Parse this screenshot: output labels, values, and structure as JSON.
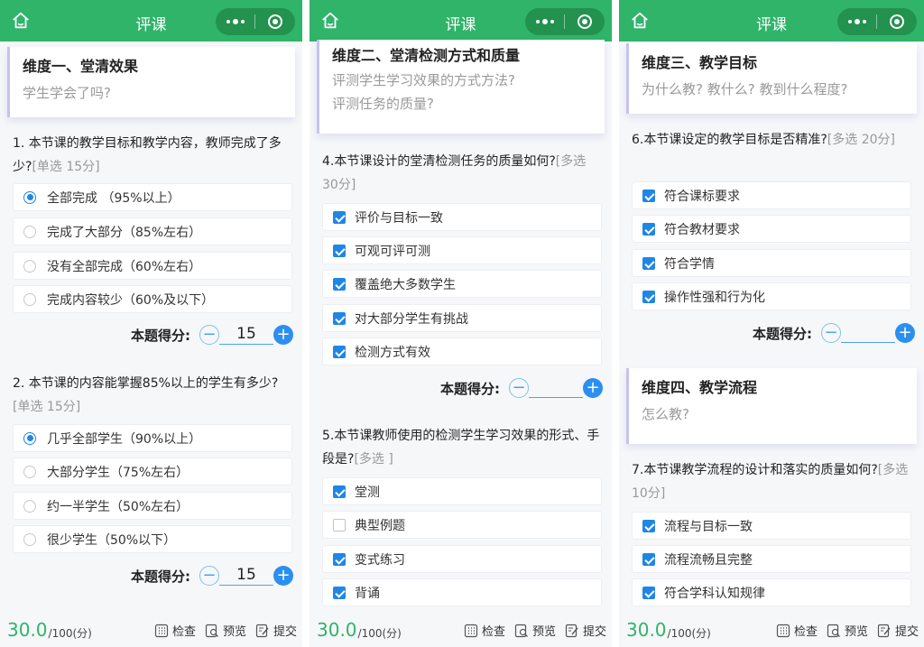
{
  "header": {
    "title": "评课"
  },
  "footer": {
    "total": "30.0",
    "of": "/100(分)",
    "check": "检查",
    "preview": "预览",
    "submit": "提交"
  },
  "p1": {
    "dim": {
      "title": "维度一、堂清效果",
      "sub": "学生学会了吗?"
    },
    "q1": {
      "text": "1. 本节课的教学目标和教学内容，教师完成了多少?",
      "tag": "[单选 15分]",
      "options": [
        "全部完成 （95%以上）",
        "完成了大部分（85%左右）",
        "没有全部完成（60%左右）",
        "完成内容较少（60%及以下）"
      ],
      "selected": 0,
      "score_label": "本题得分:",
      "score": "15"
    },
    "q2": {
      "text": "2. 本节课的内容能掌握85%以上的学生有多少?",
      "tag": "[单选 15分]",
      "options": [
        "几乎全部学生（90%以上）",
        "大部分学生（75%左右）",
        "约一半学生（50%左右）",
        "很少学生（50%以下）"
      ],
      "selected": 0,
      "score_label": "本题得分:",
      "score": "15"
    }
  },
  "p2": {
    "dim": {
      "title": "维度二、堂清检测方式和质量",
      "sub1": "评测学生学习效果的方式方法?",
      "sub2": "评测任务的质量?"
    },
    "q4": {
      "text": "4.本节课设计的堂清检测任务的质量如何?",
      "tag": "[多选 30分]",
      "options": [
        "评价与目标一致",
        "可观可评可测",
        "覆盖绝大多数学生",
        "对大部分学生有挑战",
        "检测方式有效"
      ],
      "checked": [
        true,
        true,
        true,
        true,
        true
      ],
      "score_label": "本题得分:",
      "score": ""
    },
    "q5": {
      "text": "5.本节课教师使用的检测学生学习效果的形式、手段是?",
      "tag": "[多选 ]",
      "options": [
        "堂测",
        "典型例题",
        "变式练习",
        "背诵"
      ],
      "checked": [
        true,
        false,
        true,
        true
      ]
    }
  },
  "p3": {
    "dim3": {
      "title": "维度三、教学目标",
      "sub": "为什么教? 教什么? 教到什么程度?"
    },
    "q6": {
      "text": "6.本节课设定的教学目标是否精准?",
      "tag": "[多选 20分]",
      "options": [
        "符合课标要求",
        "符合教材要求",
        "符合学情",
        "操作性强和行为化"
      ],
      "checked": [
        true,
        true,
        true,
        true
      ],
      "score_label": "本题得分:",
      "score": ""
    },
    "dim4": {
      "title": "维度四、教学流程",
      "sub": "怎么教?"
    },
    "q7": {
      "text": "7.本节课教学流程的设计和落实的质量如何?",
      "tag": "[多选 10分]",
      "options": [
        "流程与目标一致",
        "流程流畅且完整",
        "符合学科认知规律"
      ],
      "checked": [
        true,
        true,
        true
      ]
    }
  }
}
